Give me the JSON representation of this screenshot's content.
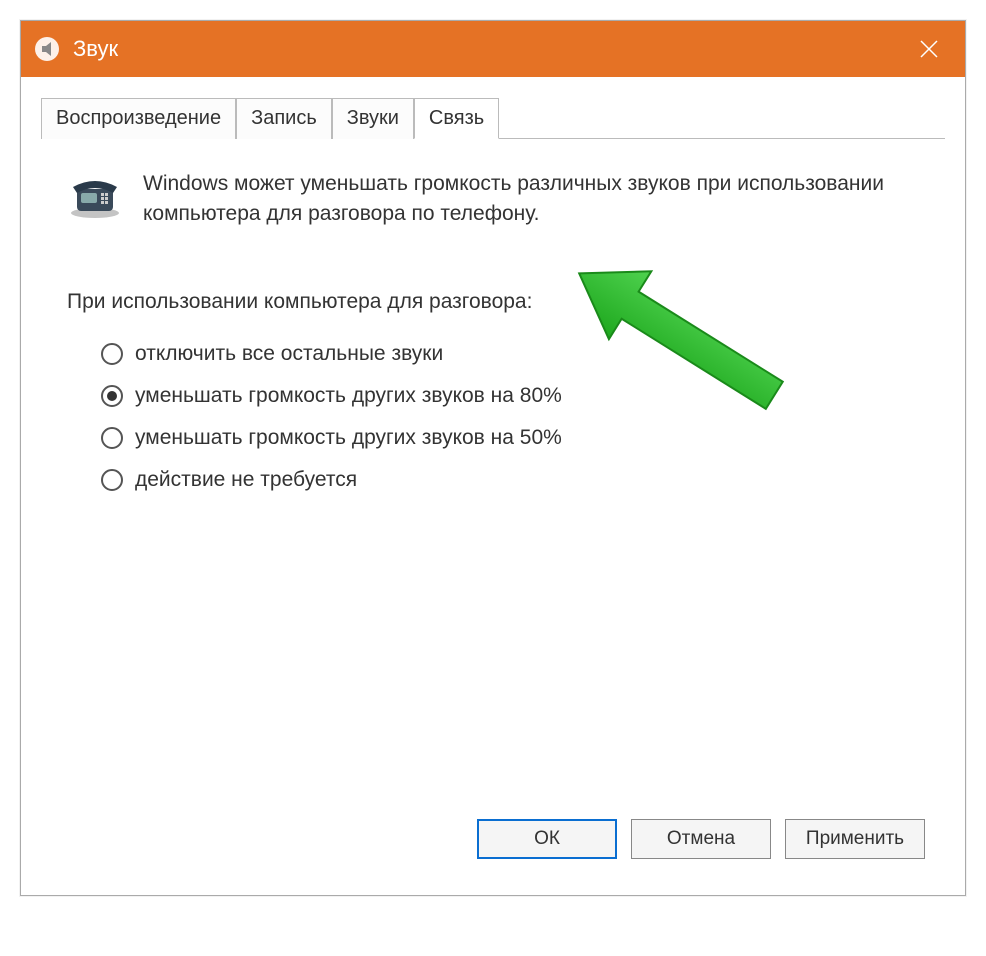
{
  "window": {
    "title": "Звук"
  },
  "tabs": {
    "playback": "Воспроизведение",
    "recording": "Запись",
    "sounds": "Звуки",
    "communications": "Связь"
  },
  "info": {
    "text": "Windows может уменьшать громкость различных звуков при использовании компьютера для разговора по телефону."
  },
  "section": {
    "label": "При использовании компьютера для разговора:"
  },
  "options": {
    "mute": "отключить все остальные звуки",
    "reduce80": "уменьшать громкость других звуков на 80%",
    "reduce50": "уменьшать громкость других звуков на 50%",
    "none": "действие не требуется"
  },
  "buttons": {
    "ok": "ОК",
    "cancel": "Отмена",
    "apply": "Применить"
  }
}
